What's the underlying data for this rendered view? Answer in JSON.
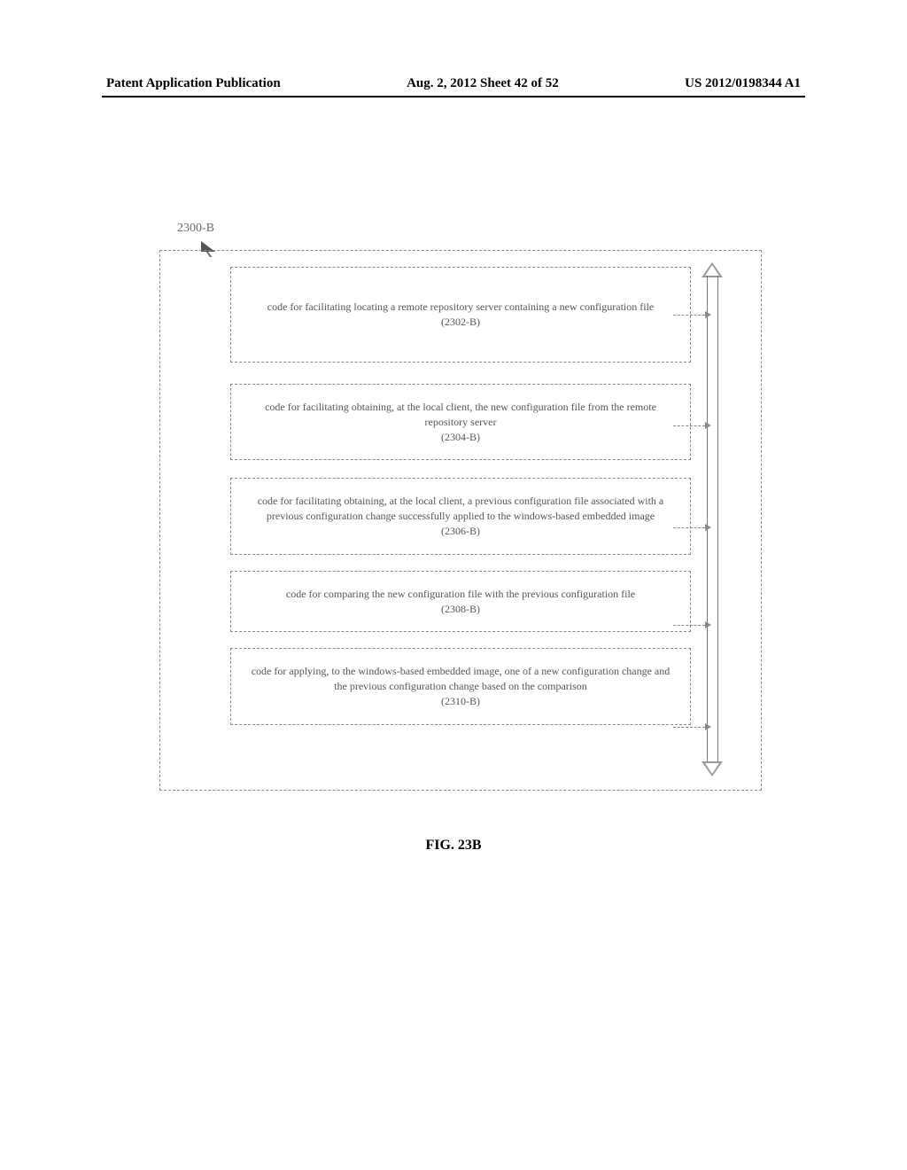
{
  "header": {
    "left": "Patent Application Publication",
    "center": "Aug. 2, 2012  Sheet 42 of 52",
    "right": "US 2012/0198344 A1"
  },
  "figure": {
    "label": "2300-B",
    "caption": "FIG. 23B"
  },
  "boxes": [
    {
      "text": "code for facilitating locating a remote repository server containing a new configuration file",
      "ref": "(2302-B)"
    },
    {
      "text": "code for facilitating obtaining, at the local client, the new configuration file from the remote repository server",
      "ref": "(2304-B)"
    },
    {
      "text": "code for facilitating obtaining, at the local client, a previous configuration file associated with a previous configuration change successfully applied to the windows-based embedded image",
      "ref": "(2306-B)"
    },
    {
      "text": "code for comparing the new configuration file with the previous configuration file",
      "ref": "(2308-B)"
    },
    {
      "text": "code for applying, to the windows-based embedded image, one of a new configuration change and the previous configuration change based on the comparison",
      "ref": "(2310-B)"
    }
  ]
}
